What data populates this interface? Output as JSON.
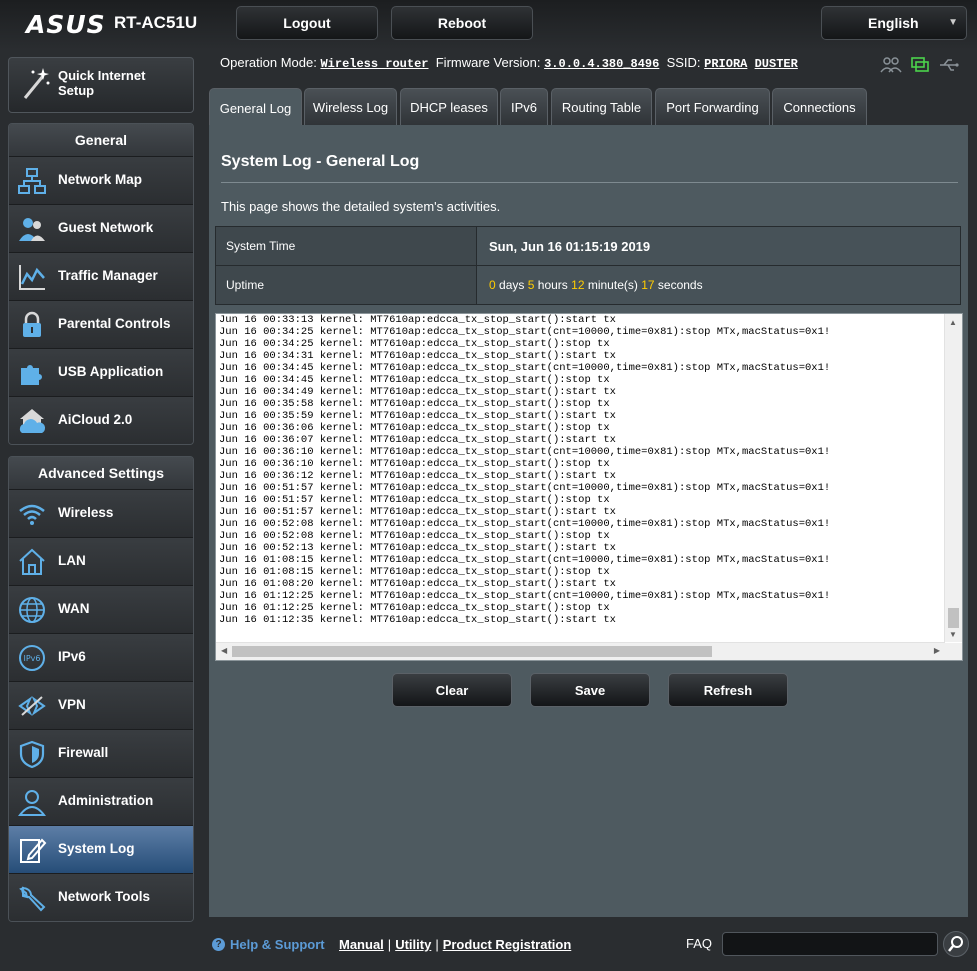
{
  "header": {
    "brand": "ASUS",
    "model": "RT-AC51U",
    "logout_label": "Logout",
    "reboot_label": "Reboot",
    "language": "English"
  },
  "status": {
    "operation_mode_label": "Operation Mode:",
    "operation_mode": "Wireless router",
    "firmware_label": "Firmware Version:",
    "firmware": "3.0.0.4.380_8496",
    "ssid_label": "SSID:",
    "ssid_1": "PRIORA",
    "ssid_2": "DUSTER"
  },
  "sidebar": {
    "quick_setup": "Quick Internet Setup",
    "general_header": "General",
    "general_items": [
      {
        "label": "Network Map",
        "icon": "network-map-icon"
      },
      {
        "label": "Guest Network",
        "icon": "guest-network-icon"
      },
      {
        "label": "Traffic Manager",
        "icon": "traffic-manager-icon"
      },
      {
        "label": "Parental Controls",
        "icon": "lock-icon"
      },
      {
        "label": "USB Application",
        "icon": "puzzle-icon"
      },
      {
        "label": "AiCloud 2.0",
        "icon": "cloud-icon"
      }
    ],
    "advanced_header": "Advanced Settings",
    "advanced_items": [
      {
        "label": "Wireless",
        "icon": "wifi-icon"
      },
      {
        "label": "LAN",
        "icon": "home-icon"
      },
      {
        "label": "WAN",
        "icon": "globe-icon"
      },
      {
        "label": "IPv6",
        "icon": "ipv6-icon"
      },
      {
        "label": "VPN",
        "icon": "vpn-icon"
      },
      {
        "label": "Firewall",
        "icon": "shield-icon"
      },
      {
        "label": "Administration",
        "icon": "admin-icon"
      },
      {
        "label": "System Log",
        "icon": "system-log-icon"
      },
      {
        "label": "Network Tools",
        "icon": "wrench-icon"
      }
    ]
  },
  "tabs": [
    {
      "label": "General Log",
      "active": true
    },
    {
      "label": "Wireless Log"
    },
    {
      "label": "DHCP leases"
    },
    {
      "label": "IPv6"
    },
    {
      "label": "Routing Table"
    },
    {
      "label": "Port Forwarding"
    },
    {
      "label": "Connections"
    }
  ],
  "main": {
    "title": "System Log - General Log",
    "description": "This page shows the detailed system's activities.",
    "system_time_label": "System Time",
    "system_time": "Sun, Jun 16 01:15:19 2019",
    "uptime_label": "Uptime",
    "uptime": {
      "days": "0",
      "days_unit": "days",
      "hours": "5",
      "hours_unit": "hours",
      "minutes": "12",
      "minutes_unit": "minute(s)",
      "seconds": "17",
      "seconds_unit": "seconds"
    },
    "log_lines": [
      "Jun 16 00:33:13 kernel: MT7610ap:edcca_tx_stop_start():start tx",
      "Jun 16 00:34:25 kernel: MT7610ap:edcca_tx_stop_start(cnt=10000,time=0x81):stop MTx,macStatus=0x1!",
      "Jun 16 00:34:25 kernel: MT7610ap:edcca_tx_stop_start():stop tx",
      "Jun 16 00:34:31 kernel: MT7610ap:edcca_tx_stop_start():start tx",
      "Jun 16 00:34:45 kernel: MT7610ap:edcca_tx_stop_start(cnt=10000,time=0x81):stop MTx,macStatus=0x1!",
      "Jun 16 00:34:45 kernel: MT7610ap:edcca_tx_stop_start():stop tx",
      "Jun 16 00:34:49 kernel: MT7610ap:edcca_tx_stop_start():start tx",
      "Jun 16 00:35:58 kernel: MT7610ap:edcca_tx_stop_start():stop tx",
      "Jun 16 00:35:59 kernel: MT7610ap:edcca_tx_stop_start():start tx",
      "Jun 16 00:36:06 kernel: MT7610ap:edcca_tx_stop_start():stop tx",
      "Jun 16 00:36:07 kernel: MT7610ap:edcca_tx_stop_start():start tx",
      "Jun 16 00:36:10 kernel: MT7610ap:edcca_tx_stop_start(cnt=10000,time=0x81):stop MTx,macStatus=0x1!",
      "Jun 16 00:36:10 kernel: MT7610ap:edcca_tx_stop_start():stop tx",
      "Jun 16 00:36:12 kernel: MT7610ap:edcca_tx_stop_start():start tx",
      "Jun 16 00:51:57 kernel: MT7610ap:edcca_tx_stop_start(cnt=10000,time=0x81):stop MTx,macStatus=0x1!",
      "Jun 16 00:51:57 kernel: MT7610ap:edcca_tx_stop_start():stop tx",
      "Jun 16 00:51:57 kernel: MT7610ap:edcca_tx_stop_start():start tx",
      "Jun 16 00:52:08 kernel: MT7610ap:edcca_tx_stop_start(cnt=10000,time=0x81):stop MTx,macStatus=0x1!",
      "Jun 16 00:52:08 kernel: MT7610ap:edcca_tx_stop_start():stop tx",
      "Jun 16 00:52:13 kernel: MT7610ap:edcca_tx_stop_start():start tx",
      "Jun 16 01:08:15 kernel: MT7610ap:edcca_tx_stop_start(cnt=10000,time=0x81):stop MTx,macStatus=0x1!",
      "Jun 16 01:08:15 kernel: MT7610ap:edcca_tx_stop_start():stop tx",
      "Jun 16 01:08:20 kernel: MT7610ap:edcca_tx_stop_start():start tx",
      "Jun 16 01:12:25 kernel: MT7610ap:edcca_tx_stop_start(cnt=10000,time=0x81):stop MTx,macStatus=0x1!",
      "Jun 16 01:12:25 kernel: MT7610ap:edcca_tx_stop_start():stop tx",
      "Jun 16 01:12:35 kernel: MT7610ap:edcca_tx_stop_start():start tx"
    ],
    "clear_label": "Clear",
    "save_label": "Save",
    "refresh_label": "Refresh"
  },
  "footer": {
    "help_label": "Help & Support",
    "manual": "Manual",
    "utility": "Utility",
    "product_registration": "Product Registration",
    "separator": "|",
    "faq_label": "FAQ"
  },
  "colors": {
    "accent_yellow": "#ffcc00",
    "help_blue": "#5c9bd6",
    "active_item": "#264d78",
    "status_icon_green": "#4cd44c"
  }
}
